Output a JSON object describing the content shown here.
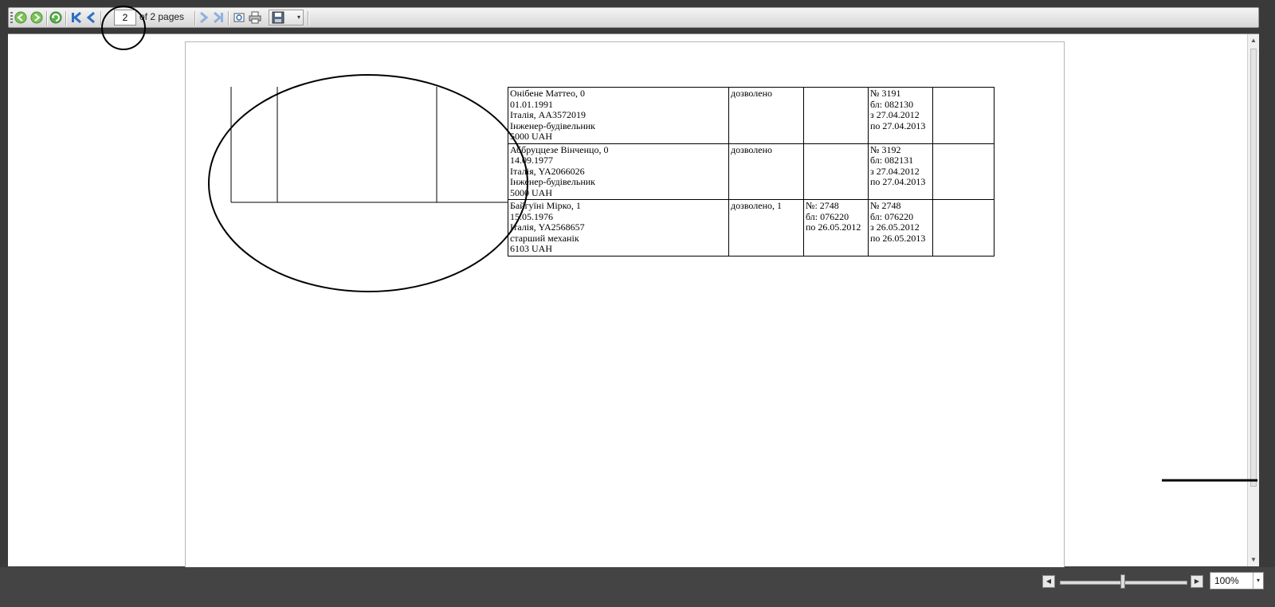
{
  "toolbar": {
    "current_page": "2",
    "page_of_label": "of 2 pages",
    "buttons": [
      "back-icon",
      "forward-icon",
      "refresh-icon",
      "first-page-icon",
      "previous-page-icon",
      "next-page-icon",
      "last-page-icon",
      "page-setup-icon",
      "print-icon",
      "save-icon"
    ]
  },
  "report": {
    "rows": [
      {
        "person": [
          "Онібене Маттео, 0",
          "01.01.1991",
          "Італія, АА3572019",
          "Інженер-будівельник",
          "5000 UAH"
        ],
        "status": "дозволено",
        "prev_permit": [],
        "permit": [
          "№ 3191",
          "бл: 082130",
          "з 27.04.2012",
          "по 27.04.2013"
        ],
        "note": ""
      },
      {
        "person": [
          "Аббруццезе Вінченцо, 0",
          "14.09.1977",
          "Італія, YA2066026",
          "Інженер-будівельник",
          "5000 UAH"
        ],
        "status": "дозволено",
        "prev_permit": [],
        "permit": [
          "№ 3192",
          "бл: 082131",
          "з 27.04.2012",
          "по 27.04.2013"
        ],
        "note": ""
      },
      {
        "person": [
          "Байгуїні Мірко, 1",
          "15.05.1976",
          "Італія, YA2568657",
          "старший механік",
          "6103 UAH"
        ],
        "status": "дозволено, 1",
        "prev_permit": [
          "№: 2748",
          "бл: 076220",
          "по 26.05.2012"
        ],
        "permit": [
          "№ 2748",
          "бл: 076220",
          "з 26.05.2012",
          "по 26.05.2013"
        ],
        "note": ""
      }
    ]
  },
  "statusbar": {
    "zoom_value": "100%",
    "zoom_level_percent": 50
  }
}
